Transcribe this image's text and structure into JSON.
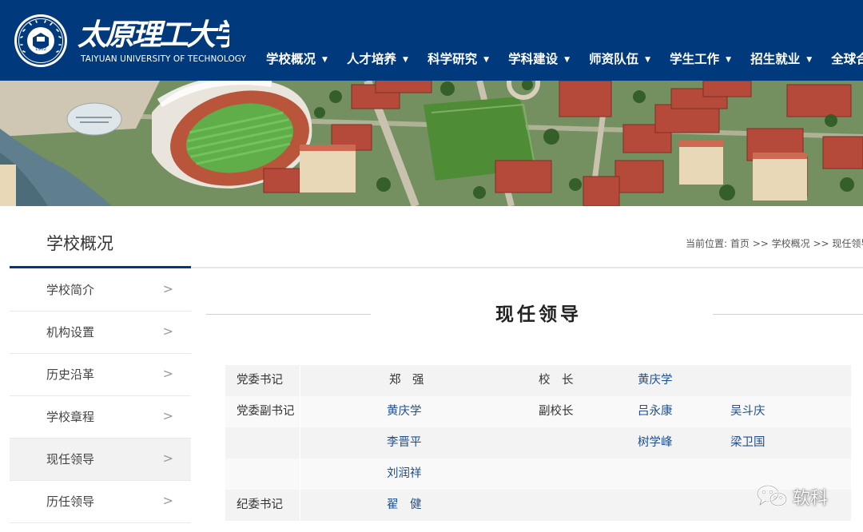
{
  "header": {
    "logo_name": "太原理工大学",
    "logo_en": "TAIYUAN UNIVERSITY OF TECHNOLOGY",
    "seal_year": "1902",
    "nav": [
      {
        "label": "学校概况"
      },
      {
        "label": "人才培养"
      },
      {
        "label": "科学研究"
      },
      {
        "label": "学科建设"
      },
      {
        "label": "师资队伍"
      },
      {
        "label": "学生工作"
      },
      {
        "label": "招生就业"
      },
      {
        "label": "全球合作"
      }
    ],
    "bg_color": "#013a7c"
  },
  "sidebar": {
    "title": "学校概况",
    "items": [
      {
        "label": "学校简介",
        "arrow": ">"
      },
      {
        "label": "机构设置",
        "arrow": ">"
      },
      {
        "label": "历史沿革",
        "arrow": ">"
      },
      {
        "label": "学校章程",
        "arrow": ">"
      },
      {
        "label": "现任领导",
        "arrow": ">",
        "active": true
      },
      {
        "label": "历任领导",
        "arrow": ">"
      }
    ]
  },
  "breadcrumb": {
    "prefix": "当前位置: ",
    "items": [
      "首页",
      "学校概况",
      "现任领导"
    ],
    "separator": " >> "
  },
  "content": {
    "title": "现任领导",
    "rows": [
      {
        "left_role": "党委书记",
        "left_names": [
          "郑　强"
        ],
        "right_role": "校　长",
        "right_names": [
          "黄庆学"
        ]
      },
      {
        "left_role": "党委副书记",
        "left_names": [
          "黄庆学"
        ],
        "right_role": "副校长",
        "right_names": [
          "吕永康",
          "吴斗庆"
        ]
      },
      {
        "left_role": "",
        "left_names": [
          "李晋平"
        ],
        "right_role": "",
        "right_names": [
          "树学峰",
          "梁卫国"
        ]
      },
      {
        "left_role": "",
        "left_names": [
          "刘润祥"
        ],
        "right_role": "",
        "right_names": []
      },
      {
        "left_role": "纪委书记",
        "left_names": [
          "翟　健"
        ],
        "right_role": "",
        "right_names": []
      }
    ]
  },
  "watermark": {
    "text": "软科",
    "icon": "wechat-icon"
  }
}
